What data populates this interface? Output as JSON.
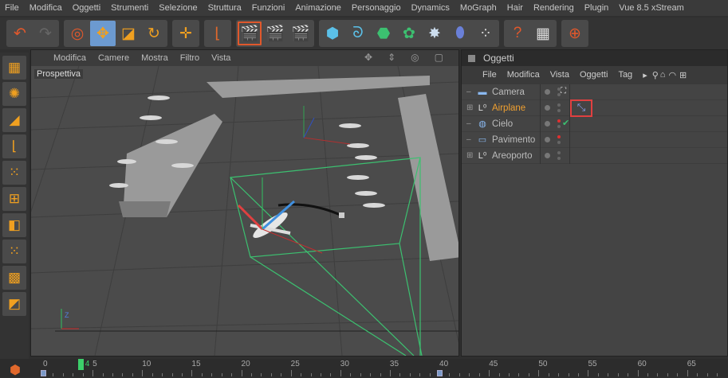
{
  "menubar": [
    "File",
    "Modifica",
    "Oggetti",
    "Strumenti",
    "Selezione",
    "Struttura",
    "Funzioni",
    "Animazione",
    "Personaggio",
    "Dynamics",
    "MoGraph",
    "Hair",
    "Rendering",
    "Plugin",
    "Vue 8.5 xStream"
  ],
  "toolbar": [
    [
      {
        "icon": "undo-icon",
        "g": "↶",
        "c": "#e0582c"
      },
      {
        "icon": "redo-icon",
        "g": "↷",
        "c": "#666"
      }
    ],
    [
      {
        "icon": "select-icon",
        "g": "◎",
        "c": "#e0582c"
      },
      {
        "icon": "move-icon",
        "g": "✥",
        "c": "#f0a020",
        "active": true
      },
      {
        "icon": "scale-icon",
        "g": "◪",
        "c": "#f0a020"
      },
      {
        "icon": "rotate-icon",
        "g": "↻",
        "c": "#f0a020"
      }
    ],
    [
      {
        "icon": "axis-move-icon",
        "g": "✛",
        "c": "#f0a020"
      }
    ],
    [
      {
        "icon": "coordinate-system-icon",
        "g": "⌊",
        "c": "#e0682c"
      }
    ],
    [
      {
        "icon": "render-view-icon",
        "g": "🎬",
        "c": "#ddd",
        "sel": true
      },
      {
        "icon": "render-picture-icon",
        "g": "🎬",
        "c": "#e0582c"
      },
      {
        "icon": "render-settings-icon",
        "g": "🎬",
        "c": "#ddd"
      }
    ],
    [
      {
        "icon": "cube-icon",
        "g": "⬢",
        "c": "#5bc0e8"
      },
      {
        "icon": "spline-icon",
        "g": "ᘐ",
        "c": "#5bc0e8"
      },
      {
        "icon": "nurbs-icon",
        "g": "⬣",
        "c": "#3cc070"
      },
      {
        "icon": "array-icon",
        "g": "✿",
        "c": "#3cc070"
      },
      {
        "icon": "deformer-icon",
        "g": "✸",
        "c": "#cde"
      },
      {
        "icon": "floor-icon",
        "g": "⬮",
        "c": "#6a80d8"
      },
      {
        "icon": "particles-icon",
        "g": "⁘",
        "c": "#ddd"
      }
    ],
    [
      {
        "icon": "help-icon",
        "g": "?",
        "c": "#e0582c"
      },
      {
        "icon": "table-help-icon",
        "g": "▦",
        "c": "#ddd"
      }
    ],
    [
      {
        "icon": "globe-icon",
        "g": "⊕",
        "c": "#e0582c"
      }
    ]
  ],
  "left_tools": [
    {
      "icon": "layout-icon",
      "g": "▦"
    },
    {
      "icon": "sculpt-icon",
      "g": "✺"
    },
    {
      "icon": "model-icon",
      "g": "◢",
      "active": true
    },
    {
      "icon": "object-axis-icon",
      "g": "⌊"
    },
    {
      "icon": "points-icon",
      "g": "⁙"
    },
    {
      "icon": "edges-icon",
      "g": "⊞"
    },
    {
      "icon": "polygons-icon",
      "g": "◧"
    },
    {
      "icon": "uvw-icon",
      "g": "⁙",
      "active": true
    },
    {
      "icon": "texture-icon",
      "g": "▩"
    },
    {
      "icon": "workplane-icon",
      "g": "◩"
    }
  ],
  "viewport": {
    "menu": [
      "Modifica",
      "Camere",
      "Mostra",
      "Filtro",
      "Vista"
    ],
    "label": "Prospettiva"
  },
  "object_manager": {
    "title": "Oggetti",
    "menu": [
      "File",
      "Modifica",
      "Vista",
      "Oggetti",
      "Tag"
    ],
    "objects": [
      {
        "name": "Camera",
        "icon": "camera-icon",
        "g": "▬",
        "expand": false,
        "selected": false,
        "render_dot": "#666",
        "editor_dot": "#666",
        "tag": "camera-target-tag-icon"
      },
      {
        "name": "Airplane",
        "icon": "null-object-icon",
        "g": "L⁰",
        "expand": true,
        "selected": true,
        "render_dot": "#666",
        "editor_dot": "#666",
        "tag": "align-to-spline-tag-icon"
      },
      {
        "name": "Cielo",
        "icon": "sky-icon",
        "g": "◍",
        "expand": false,
        "selected": false,
        "render_dot": "#e03030",
        "editor_dot": "#666",
        "check": "✔"
      },
      {
        "name": "Pavimento",
        "icon": "floor-icon",
        "g": "▭",
        "expand": false,
        "selected": false,
        "render_dot": "#e03030",
        "editor_dot": "#666"
      },
      {
        "name": "Areoporto",
        "icon": "null-object-icon",
        "g": "L⁰",
        "expand": true,
        "selected": false,
        "render_dot": "#666",
        "editor_dot": "#666"
      }
    ]
  },
  "timeline": {
    "ticks": [
      "0",
      "5",
      "10",
      "15",
      "20",
      "25",
      "30",
      "35",
      "40",
      "45",
      "50",
      "55",
      "60",
      "65"
    ],
    "current_frame": "4",
    "accent": "#3ccf6a"
  }
}
